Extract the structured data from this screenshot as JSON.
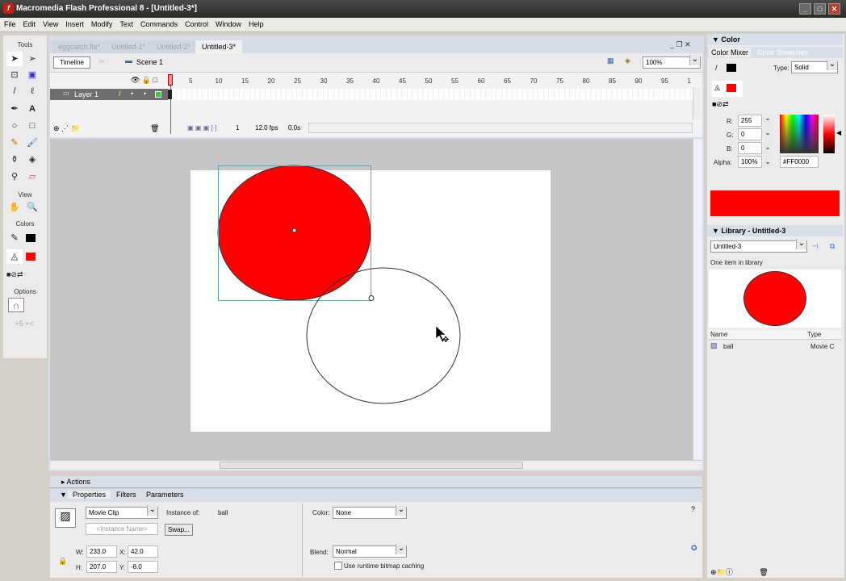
{
  "window": {
    "title": "Macromedia Flash Professional 8 - [Untitled-3*]",
    "logo": "f"
  },
  "menu": [
    "File",
    "Edit",
    "View",
    "Insert",
    "Modify",
    "Text",
    "Commands",
    "Control",
    "Window",
    "Help"
  ],
  "tools": {
    "title": "Tools",
    "view": "View",
    "colors": "Colors",
    "options": "Options"
  },
  "doc_tabs": [
    "eggcatch.fla*",
    "Untitled-1*",
    "Untitled-2*",
    "Untitled-3*"
  ],
  "editbar": {
    "timeline": "Timeline",
    "scene": "Scene 1",
    "zoom": "100%"
  },
  "timeline": {
    "frame_numbers": [
      "5",
      "10",
      "15",
      "20",
      "25",
      "30",
      "35",
      "40",
      "45",
      "50",
      "55",
      "60",
      "65",
      "70",
      "75",
      "80",
      "85",
      "90",
      "95",
      "1"
    ],
    "layer": "Layer 1",
    "current_frame": "1",
    "fps": "12.0 fps",
    "time": "0.0s"
  },
  "panels": {
    "actions": "Actions",
    "tabs": [
      "Properties",
      "Filters",
      "Parameters"
    ]
  },
  "properties": {
    "symbol_type": "Movie Clip",
    "instance_name_placeholder": "<Instance Name>",
    "instance_of_label": "Instance of:",
    "instance_of": "ball",
    "swap": "Swap...",
    "color_label": "Color:",
    "color": "None",
    "w_label": "W:",
    "w": "233.0",
    "h_label": "H:",
    "h": "207.0",
    "x_label": "X:",
    "x": "42.0",
    "y_label": "Y:",
    "y": "-8.0",
    "blend_label": "Blend:",
    "blend": "Normal",
    "cache_label": "Use runtime bitmap caching"
  },
  "color_panel": {
    "title": "Color",
    "tabs": [
      "Color Mixer",
      "Color Swatches"
    ],
    "type_label": "Type:",
    "type": "Solid",
    "r_label": "R:",
    "r": "255",
    "g_label": "G:",
    "g": "0",
    "b_label": "B:",
    "b": "0",
    "alpha_label": "Alpha:",
    "alpha": "100%",
    "hex": "#FF0000",
    "fill": "#ff0000"
  },
  "library": {
    "title": "Library - Untitled-3",
    "select": "Untitled-3",
    "count": "One item in library",
    "col_name": "Name",
    "col_type": "Type",
    "items": [
      {
        "name": "ball",
        "type": "Movie C"
      }
    ]
  }
}
